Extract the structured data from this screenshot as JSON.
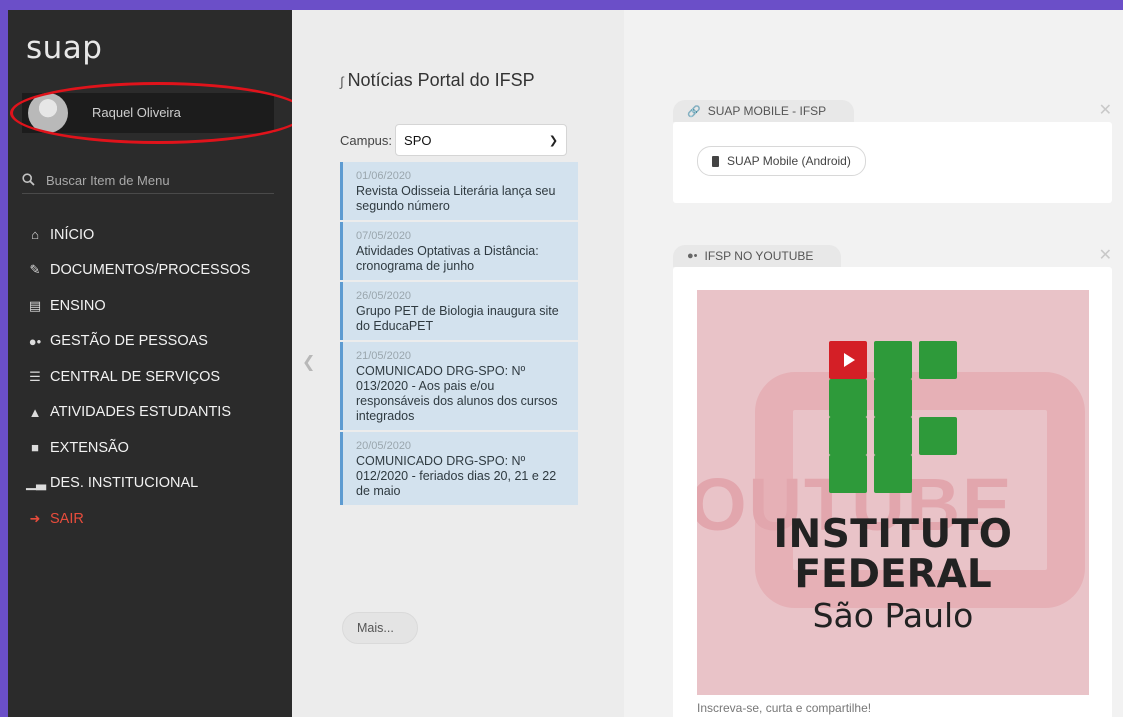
{
  "sidebar": {
    "logo": "suap",
    "user_name": "Raquel Oliveira",
    "search_placeholder": "Buscar Item de Menu",
    "menu": [
      {
        "label": "INÍCIO",
        "icon": "home-icon"
      },
      {
        "label": "DOCUMENTOS/PROCESSOS",
        "icon": "document-edit-icon"
      },
      {
        "label": "ENSINO",
        "icon": "chalkboard-icon"
      },
      {
        "label": "GESTÃO DE PESSOAS",
        "icon": "users-icon"
      },
      {
        "label": "CENTRAL DE SERVIÇOS",
        "icon": "list-icon"
      },
      {
        "label": "ATIVIDADES ESTUDANTIS",
        "icon": "graduation-cap-icon"
      },
      {
        "label": "EXTENSÃO",
        "icon": "building-icon"
      },
      {
        "label": "DES. INSTITUCIONAL",
        "icon": "bar-chart-icon"
      },
      {
        "label": "SAIR",
        "icon": "sign-out-icon"
      }
    ]
  },
  "news": {
    "title": "Notícias Portal do IFSP",
    "campus_label": "Campus:",
    "campus_value": "SPO",
    "items": [
      {
        "date": "01/06/2020",
        "text": "Revista Odisseia Literária lança seu segundo número"
      },
      {
        "date": "07/05/2020",
        "text": "Atividades Optativas a Distância: cronograma de junho"
      },
      {
        "date": "26/05/2020",
        "text": "Grupo PET de Biologia inaugura site do EducaPET"
      },
      {
        "date": "21/05/2020",
        "text": "COMUNICADO DRG-SPO: Nº 013/2020 - Aos pais e/ou responsáveis dos alunos dos cursos integrados"
      },
      {
        "date": "20/05/2020",
        "text": "COMUNICADO DRG-SPO: Nº 012/2020 - feriados dias 20, 21 e 22 de maio"
      }
    ],
    "more_label": "Mais..."
  },
  "panels": {
    "mobile": {
      "title": "SUAP MOBILE - IFSP",
      "button": "SUAP Mobile (Android)"
    },
    "youtube": {
      "title": "IFSP NO YOUTUBE",
      "logo_line1": "INSTITUTO",
      "logo_line2": "FEDERAL",
      "logo_line3": "São Paulo",
      "bg_text": "OUTUBE",
      "caption": "Inscreva-se, curta e compartilhe!"
    }
  },
  "colors": {
    "sidebar_bg": "#2b2b2b",
    "accent_blue": "#5d9bd1",
    "annotation_red": "#e0131b",
    "logout_red": "#e74c3c",
    "if_green": "#2e9a3a",
    "if_red": "#d41f26"
  }
}
